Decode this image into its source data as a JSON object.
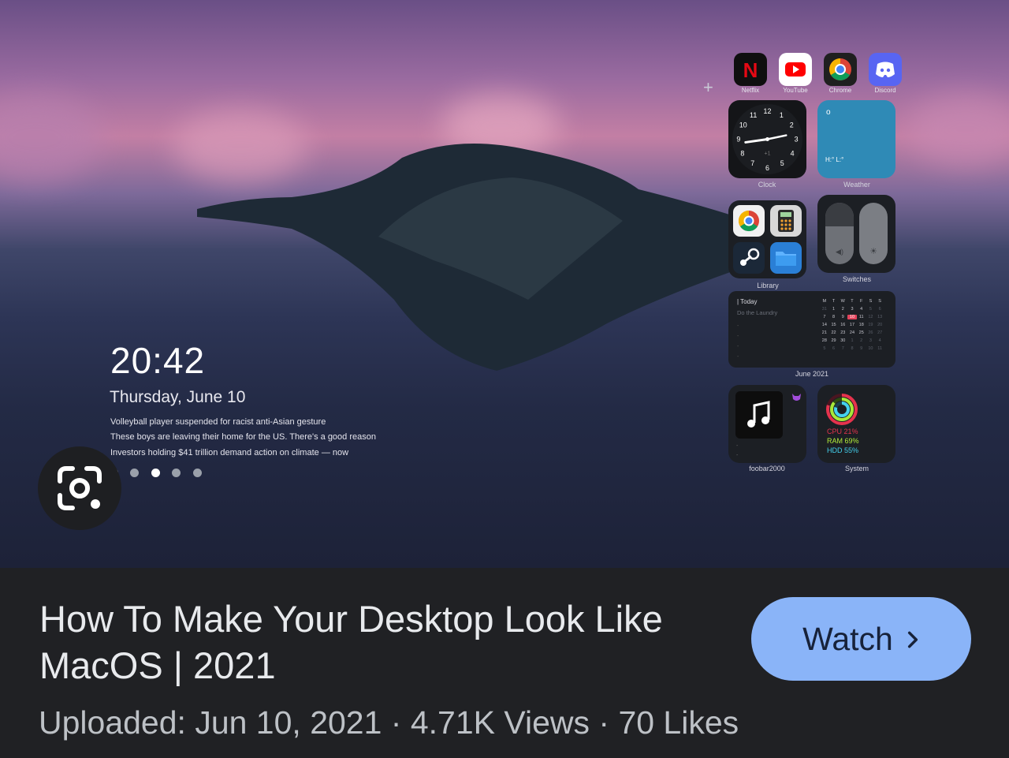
{
  "desktop": {
    "time": "20:42",
    "date": "Thursday, June 10",
    "news": [
      "Volleyball player suspended for racist anti-Asian gesture",
      "These boys are leaving their home for the US. There's a good reason",
      "Investors holding $41 trillion demand action on climate — now"
    ],
    "apps": [
      {
        "label": "Netflix",
        "icon": "netflix-icon"
      },
      {
        "label": "YouTube",
        "icon": "youtube-icon"
      },
      {
        "label": "Chrome",
        "icon": "chrome-icon"
      },
      {
        "label": "Discord",
        "icon": "discord-icon"
      }
    ],
    "widgets": {
      "clock_label": "Clock",
      "clock_numbers": [
        "12",
        "1",
        "2",
        "3",
        "4",
        "5",
        "6",
        "7",
        "8",
        "9",
        "10",
        "11"
      ],
      "clock_offset": "+1",
      "weather_label": "Weather",
      "weather_temp": "o",
      "weather_hl": "H:° L:°",
      "library_label": "Library",
      "switches_label": "Switches",
      "calendar_today": "| Today",
      "calendar_task": "Do the Laundry",
      "calendar_label": "June 2021",
      "calendar_weekdays": [
        "M",
        "T",
        "W",
        "T",
        "F",
        "S",
        "S"
      ],
      "calendar_days": [
        [
          "31",
          "1",
          "2",
          "3",
          "4",
          "5",
          "6"
        ],
        [
          "7",
          "8",
          "9",
          "10",
          "11",
          "12",
          "13"
        ],
        [
          "14",
          "15",
          "16",
          "17",
          "18",
          "19",
          "20"
        ],
        [
          "21",
          "22",
          "23",
          "24",
          "25",
          "26",
          "27"
        ],
        [
          "28",
          "29",
          "30",
          "1",
          "2",
          "3",
          "4"
        ],
        [
          "5",
          "6",
          "7",
          "8",
          "9",
          "10",
          "11"
        ]
      ],
      "music_label": "foobar2000",
      "system_label": "System",
      "cpu": "CPU 21%",
      "ram": "RAM 69%",
      "hdd": "HDD 55%"
    },
    "carousel_selected_index": 2
  },
  "video": {
    "title": "How To Make Your Desktop Look Like MacOS | 2021",
    "meta": "Uploaded: Jun 10, 2021 · 4.71K Views · 70 Likes",
    "watch_label": "Watch"
  },
  "colors": {
    "accent": "#8ab4f8",
    "background": "#202124",
    "calendar_today": "#e2445c"
  }
}
